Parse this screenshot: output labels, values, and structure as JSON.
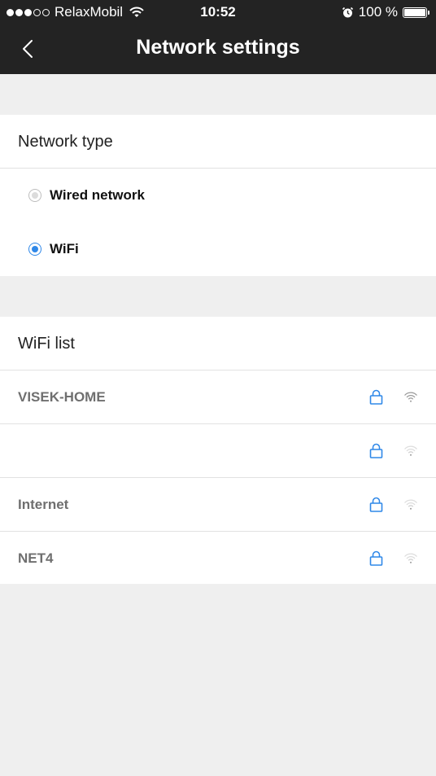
{
  "status_bar": {
    "carrier": "RelaxMobil",
    "time": "10:52",
    "battery": "100 %",
    "signal_dots_filled": 3,
    "signal_dots_total": 5
  },
  "nav": {
    "title": "Network settings",
    "back_icon": "chevron-left-icon"
  },
  "network_type": {
    "header": "Network type",
    "options": [
      {
        "label": "Wired network",
        "selected": false
      },
      {
        "label": "WiFi",
        "selected": true
      }
    ]
  },
  "wifi_list": {
    "header": "WiFi list",
    "networks": [
      {
        "name": "VISEK-HOME",
        "locked": true,
        "signal": "strong"
      },
      {
        "name": "",
        "locked": true,
        "signal": "weak"
      },
      {
        "name": "Internet",
        "locked": true,
        "signal": "weak"
      },
      {
        "name": "NET4",
        "locked": true,
        "signal": "weak"
      }
    ]
  },
  "colors": {
    "top_bar": "#232323",
    "accent_blue": "#2f88e8",
    "background": "#efefef"
  }
}
